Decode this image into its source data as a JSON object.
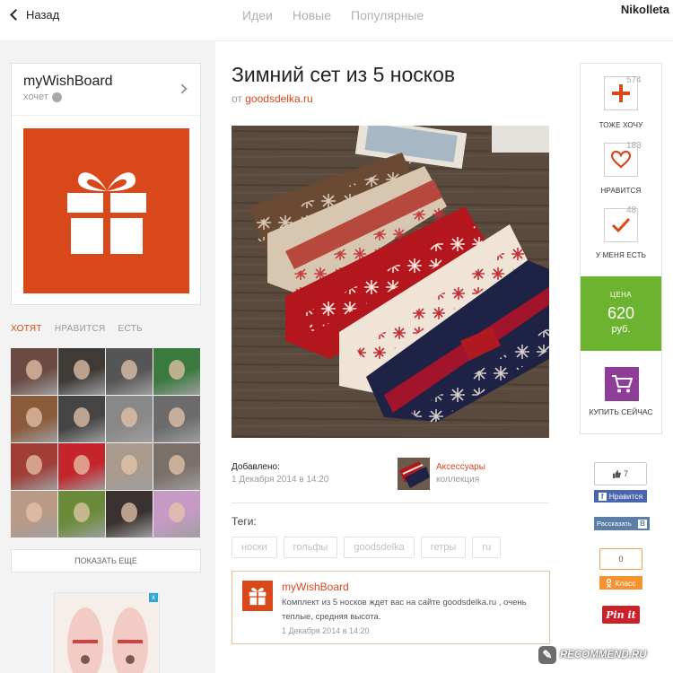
{
  "topbar": {
    "back_label": "Назад",
    "tabs": [
      "Идеи",
      "Новые",
      "Популярные"
    ],
    "user_name": "Nikolleta"
  },
  "board": {
    "title": "myWishBoard",
    "subtitle": "хочет",
    "image_color": "#d9481b",
    "icon": "gift-icon"
  },
  "left_tabs": [
    "ХОТЯТ",
    "НРАВИТСЯ",
    "ЕСТЬ"
  ],
  "avatars": {
    "colors": [
      "#6b4a44",
      "#3f3a36",
      "#555",
      "#3a7a3e",
      "#8a5a3a",
      "#444",
      "#888",
      "#6b6b6b",
      "#a03d37",
      "#c4242a",
      "#a99a8d",
      "#7b6f6a",
      "#b89a86",
      "#6a8c3a",
      "#3a3230",
      "#c69ac4"
    ]
  },
  "show_more_label": "ПОКАЗАТЬ ЕЩЕ",
  "ad": {
    "close": "x"
  },
  "item": {
    "title": "Зимний сет из 5 носков",
    "source_prefix": "от",
    "source_name": "goodsdelka.ru",
    "added_label": "Добавлено:",
    "added_date": "1 Декабря 2014 в 14:20",
    "collection_name": "Аксессуары",
    "collection_type": "коллекция",
    "tags_label": "Теги:",
    "tags": [
      "носки",
      "гольфы",
      "goodsdelka",
      "гетры",
      "ru"
    ]
  },
  "comment": {
    "author": "myWishBoard",
    "text": "Комплект из 5 носков ждет вас на сайте goodsdelka.ru , очень теплые, средняя высота.",
    "date": "1 Декабря 2014 в 14:20"
  },
  "actions": {
    "want": {
      "count": "574",
      "label": "ТОЖЕ ХОЧУ",
      "icon": "plus-icon"
    },
    "like": {
      "count": "183",
      "label": "НРАВИТСЯ",
      "icon": "heart-icon"
    },
    "have": {
      "count": "48",
      "label": "У МЕНЯ ЕСТЬ",
      "icon": "check-icon"
    },
    "price_label": "ЦЕНА",
    "price_value": "620",
    "price_currency": "руб.",
    "buy_label": "КУПИТЬ СЕЙЧАС",
    "buy_icon": "cart-icon"
  },
  "share": {
    "fb_count": "7",
    "fb_label": "Нравится",
    "vk_label": "Рассказать",
    "ok_count": "0",
    "ok_label": "Класс",
    "pin_label": "Pin it"
  },
  "watermark": "RECOMMEND.RU",
  "colors": {
    "accent": "#d9481b",
    "price_green": "#6cb42f",
    "buy_purple": "#8e3e98"
  }
}
